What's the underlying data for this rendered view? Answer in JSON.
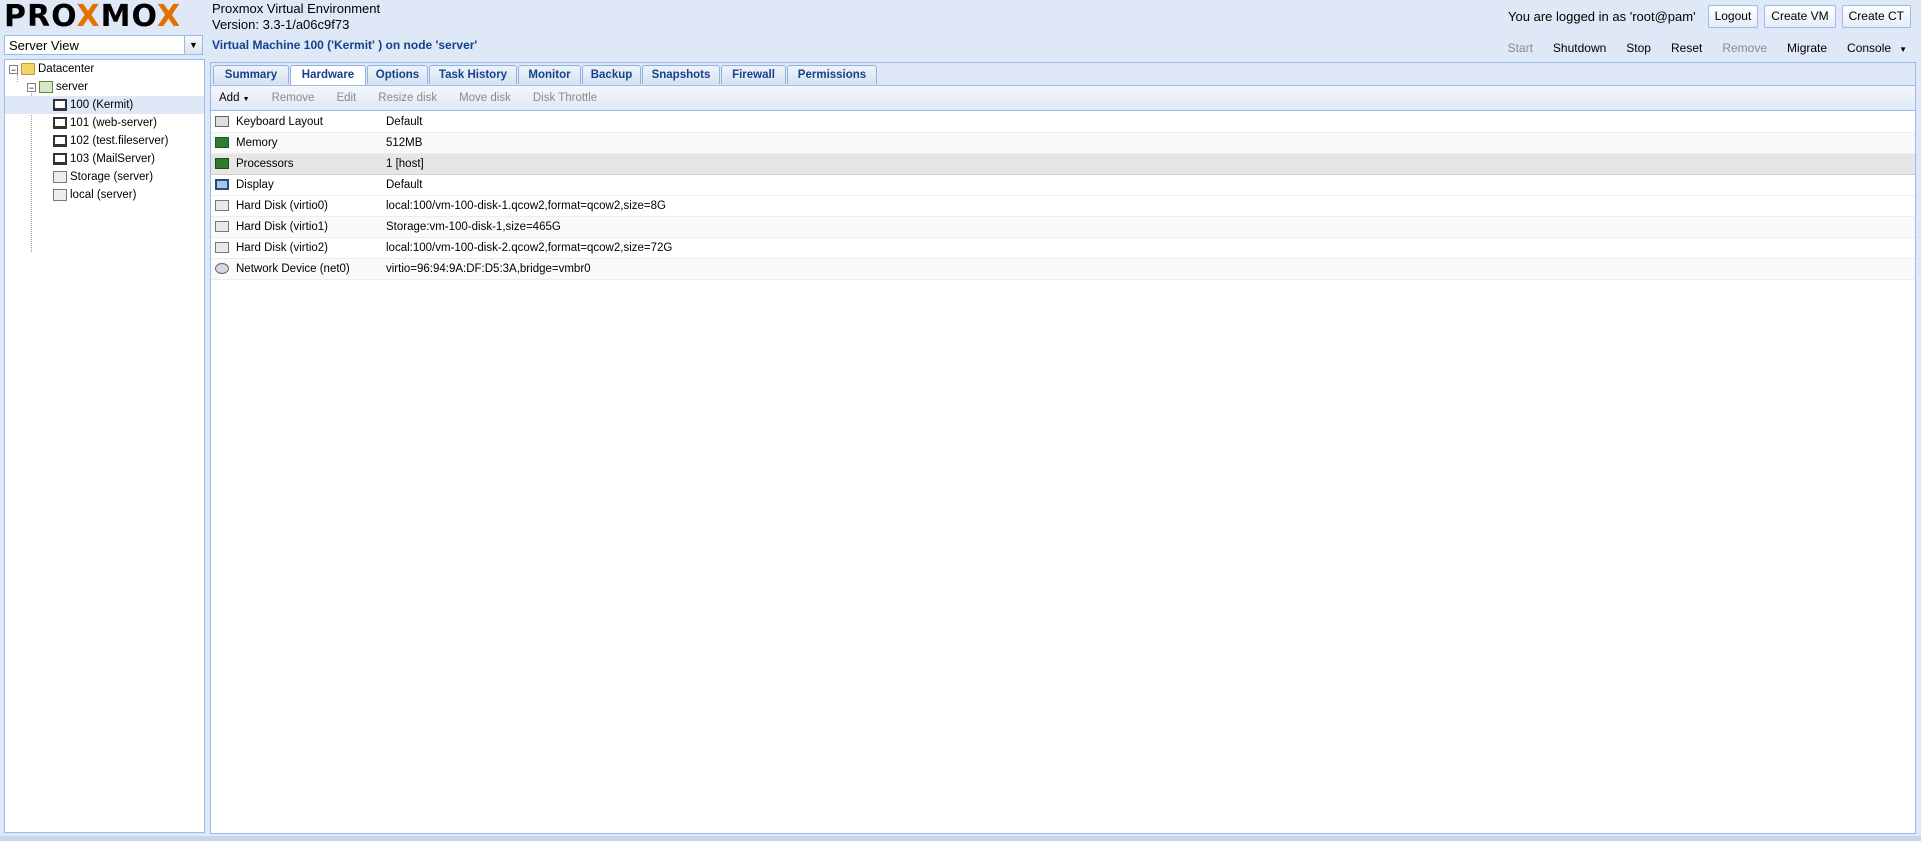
{
  "header": {
    "logo_prefix": "PRO",
    "logo_x1": "X",
    "logo_mid": "MO",
    "logo_x2": "X",
    "product_name": "Proxmox Virtual Environment",
    "version": "Version: 3.3-1/a06c9f73",
    "login_text": "You are logged in as 'root@pam'",
    "logout_label": "Logout",
    "create_vm_label": "Create VM",
    "create_ct_label": "Create CT"
  },
  "view_selector": {
    "value": "Server View"
  },
  "tree": {
    "datacenter": "Datacenter",
    "server": "server",
    "items": [
      {
        "label": "100 (Kermit)",
        "icon": "vm-icon"
      },
      {
        "label": "101 (web-server)",
        "icon": "vm-icon"
      },
      {
        "label": "102 (test.fileserver)",
        "icon": "vm-icon"
      },
      {
        "label": "103 (MailServer)",
        "icon": "vm-icon"
      },
      {
        "label": "Storage (server)",
        "icon": "storage-icon"
      },
      {
        "label": "local (server)",
        "icon": "storage-icon"
      }
    ]
  },
  "vm": {
    "title": "Virtual Machine 100 ('Kermit' ) on node 'server'",
    "toolbar": {
      "start": "Start",
      "shutdown": "Shutdown",
      "stop": "Stop",
      "reset": "Reset",
      "remove": "Remove",
      "migrate": "Migrate",
      "console": "Console"
    }
  },
  "tabs": [
    {
      "label": "Summary"
    },
    {
      "label": "Hardware"
    },
    {
      "label": "Options"
    },
    {
      "label": "Task History"
    },
    {
      "label": "Monitor"
    },
    {
      "label": "Backup"
    },
    {
      "label": "Snapshots"
    },
    {
      "label": "Firewall"
    },
    {
      "label": "Permissions"
    }
  ],
  "hardware_toolbar": {
    "add": "Add",
    "remove": "Remove",
    "edit": "Edit",
    "resize_disk": "Resize disk",
    "move_disk": "Move disk",
    "disk_throttle": "Disk Throttle"
  },
  "hardware": [
    {
      "name": "Keyboard Layout",
      "value": "Default",
      "icon": "keyboard-icon"
    },
    {
      "name": "Memory",
      "value": "512MB",
      "icon": "memory-icon"
    },
    {
      "name": "Processors",
      "value": "1 [host]",
      "icon": "cpu-icon"
    },
    {
      "name": "Display",
      "value": "Default",
      "icon": "display-icon"
    },
    {
      "name": "Hard Disk (virtio0)",
      "value": "local:100/vm-100-disk-1.qcow2,format=qcow2,size=8G",
      "icon": "harddisk-icon"
    },
    {
      "name": "Hard Disk (virtio1)",
      "value": "Storage:vm-100-disk-1,size=465G",
      "icon": "harddisk-icon"
    },
    {
      "name": "Hard Disk (virtio2)",
      "value": "local:100/vm-100-disk-2.qcow2,format=qcow2,size=72G",
      "icon": "harddisk-icon"
    },
    {
      "name": "Network Device (net0)",
      "value": "virtio=96:94:9A:DF:D5:3A,bridge=vmbr0",
      "icon": "network-icon"
    }
  ],
  "colors": {
    "accent": "#e57000",
    "title_blue": "#15428b",
    "border_blue": "#99bbe8"
  }
}
